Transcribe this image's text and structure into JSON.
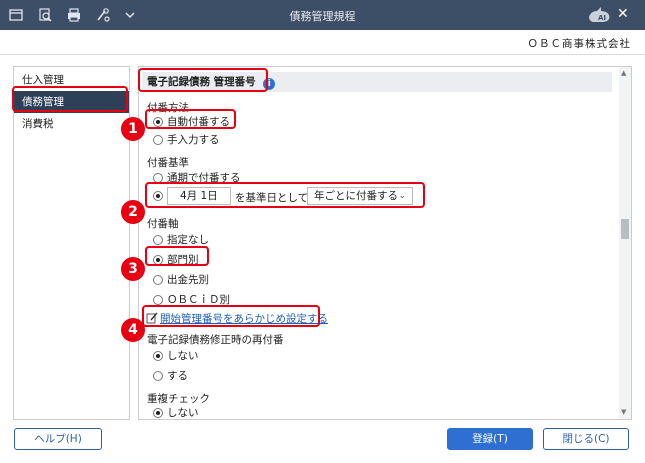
{
  "window": {
    "title": "債務管理規程",
    "close_glyph": "✕",
    "toolbar_icons": [
      "window-icon",
      "search-icon",
      "printer-icon",
      "tool-icon",
      "dropdown-icon"
    ],
    "logo_text": "AI"
  },
  "company": "ＯＢＣ商事株式会社",
  "sidebar": {
    "items": [
      {
        "label": "仕入管理",
        "active": false
      },
      {
        "label": "債務管理",
        "active": true
      },
      {
        "label": "消費税",
        "active": false
      }
    ]
  },
  "main": {
    "section_title": "電子記録債務 管理番号",
    "numbering_method": {
      "label": "付番方法",
      "options": [
        {
          "label": "自動付番する",
          "checked": true
        },
        {
          "label": "手入力する",
          "checked": false
        }
      ]
    },
    "numbering_basis": {
      "label": "付番基準",
      "option_through": "通期で付番する",
      "date_value": "4月  1日",
      "date_suffix": "を基準日として",
      "period_select": "年ごとに付番する"
    },
    "numbering_axis": {
      "label": "付番軸",
      "options": [
        {
          "label": "指定なし",
          "checked": false
        },
        {
          "label": "部門別",
          "checked": true
        },
        {
          "label": "出金先別",
          "checked": false
        },
        {
          "label": "ＯＢＣｉＤ別",
          "checked": false
        }
      ]
    },
    "preset_link": "開始管理番号をあらかじめ設定する",
    "renumber_on_edit": {
      "label": "電子記録債務修正時の再付番",
      "options": [
        {
          "label": "しない",
          "checked": true
        },
        {
          "label": "する",
          "checked": false
        }
      ]
    },
    "duplicate_check": {
      "label": "重複チェック",
      "options": [
        {
          "label": "しない",
          "checked": true
        }
      ]
    }
  },
  "callouts": [
    "1",
    "2",
    "3",
    "4"
  ],
  "footer": {
    "help": "ヘルプ(H)",
    "register": "登録(T)",
    "close": "閉じる(C)"
  },
  "colors": {
    "titlebar": "#3d4f66",
    "active_nav": "#2e3f58",
    "primary": "#2f6fd1",
    "highlight": "#e60012"
  }
}
